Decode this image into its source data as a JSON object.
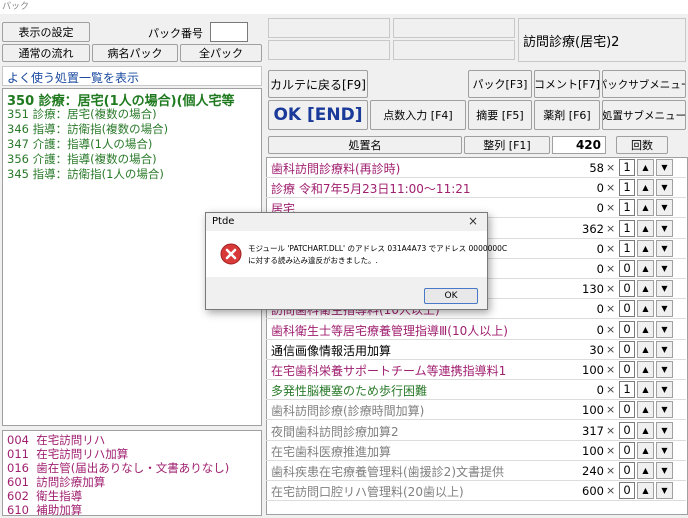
{
  "window": {
    "title": "パック"
  },
  "left": {
    "display_settings": "表示の設定",
    "pack_number_label": "パック番号",
    "pack_number_value": "",
    "tab_normal": "通常の流れ",
    "tab_disease": "病名パック",
    "tab_all": "全パック",
    "common_header": "よく使う処置一覧を表示",
    "common_items": [
      "350 診療：居宅(1人の場合)(個人宅等",
      "351 診療：居宅(複数の場合)",
      "346 指導：訪衛指(複数の場合)",
      "347 介護：指導(1人の場合)",
      "356 介護：指導(複数の場合)",
      "345 指導：訪衛指(1人の場合)"
    ],
    "lower_items": [
      {
        "code": "004",
        "label": "在宅訪問リハ"
      },
      {
        "code": "011",
        "label": "在宅訪問リハ加算"
      },
      {
        "code": "016",
        "label": "歯在管(届出ありなし・文書ありなし)"
      },
      {
        "code": "601",
        "label": "訪問診療加算"
      },
      {
        "code": "602",
        "label": "衛生指導"
      },
      {
        "code": "610",
        "label": "補助加算"
      }
    ]
  },
  "header": {
    "title": "訪問診療(居宅)2"
  },
  "toolbar": {
    "back_to_chart": "カルテに戻る[F9]",
    "pack": "パック[F3]",
    "comment": "コメント[F7]",
    "pack_submenu": "パックサブメニュー",
    "ok": "OK [END]",
    "score_input": "点数入力 [F4]",
    "summary": "摘要 [F5]",
    "medicine": "薬剤 [F6]",
    "procedure_submenu": "処置サブメニュー"
  },
  "table": {
    "col_name": "処置名",
    "col_sort": "整列 [F1]",
    "total": "420",
    "col_count": "回数",
    "rows": [
      {
        "name": "歯科訪問診療料(再診時)",
        "points": "58",
        "qty": "1",
        "color": "#a02070"
      },
      {
        "name": "診療 令和7年5月23日11:00～11:21",
        "points": "0",
        "qty": "1",
        "color": "#a02070"
      },
      {
        "name": "居宅",
        "points": "0",
        "qty": "1",
        "color": "#a02070"
      },
      {
        "name": "",
        "points": "362",
        "qty": "1",
        "color": "#a02070"
      },
      {
        "name": "",
        "points": "0",
        "qty": "1",
        "color": "#a02070"
      },
      {
        "name": "",
        "points": "0",
        "qty": "0",
        "color": "#a02070"
      },
      {
        "name": "",
        "points": "130",
        "qty": "0",
        "color": "#a02070"
      },
      {
        "name": "訪問歯科衛生指導料(10人以上)",
        "points": "0",
        "qty": "0",
        "color": "#a02070"
      },
      {
        "name": "歯科衛生士等居宅療養管理指導Ⅲ(10人以上)",
        "points": "0",
        "qty": "0",
        "color": "#a02070"
      },
      {
        "name": "通信画像情報活用加算",
        "points": "30",
        "qty": "0",
        "color": "#000000"
      },
      {
        "name": "在宅歯科栄養サポートチーム等連携指導料1",
        "points": "100",
        "qty": "0",
        "color": "#a02070"
      },
      {
        "name": "多発性脳梗塞のため歩行困難",
        "points": "0",
        "qty": "1",
        "color": "#2a7a2a"
      },
      {
        "name": "歯科訪問診療(診療時間加算)",
        "points": "100",
        "qty": "0",
        "color": "#808080"
      },
      {
        "name": "夜間歯科訪問診療加算2",
        "points": "317",
        "qty": "0",
        "color": "#808080"
      },
      {
        "name": "在宅歯科医療推進加算",
        "points": "100",
        "qty": "0",
        "color": "#808080"
      },
      {
        "name": "歯科疾患在宅療養管理料(歯援診2)文書提供",
        "points": "240",
        "qty": "0",
        "color": "#808080"
      },
      {
        "name": "在宅訪問口腔リハ管理料(20歯以上)",
        "points": "600",
        "qty": "0",
        "color": "#808080"
      }
    ]
  },
  "dialog": {
    "title": "Ptde",
    "message_line1": "モジュール 'PATCHART.DLL' のアドレス 031A4A73 でアドレス 0000000C",
    "message_line2": "に対する読み込み違反がおきました。.",
    "ok": "OK",
    "close": "×"
  },
  "glyphs": {
    "times": "×",
    "up": "▲",
    "down": "▼"
  }
}
